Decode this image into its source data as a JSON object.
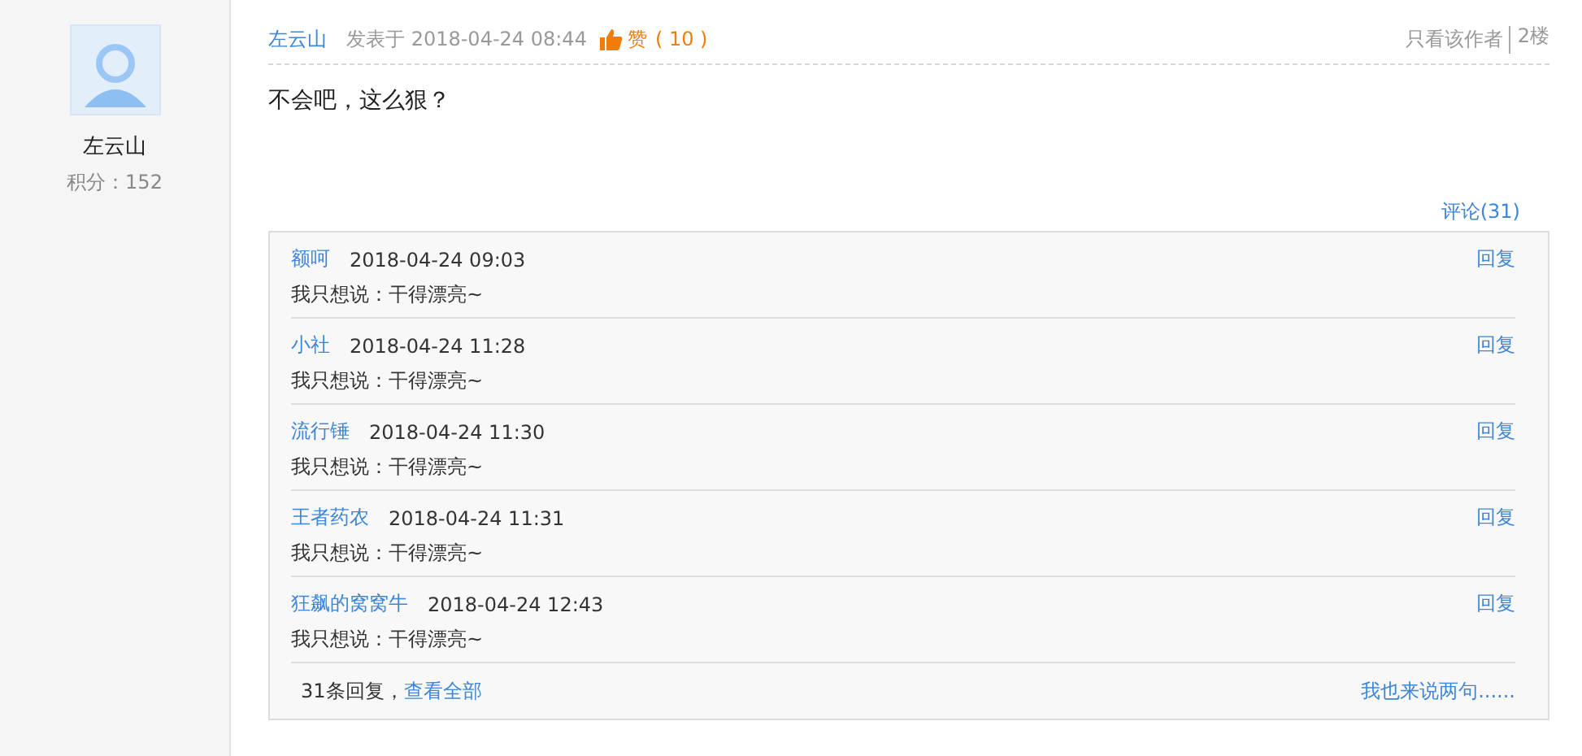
{
  "author": {
    "name": "左云山",
    "score": "积分：152"
  },
  "post": {
    "author": "左云山",
    "posted": "发表于 2018-04-24 08:44",
    "like_label": "赞",
    "like_count": "( 10 )",
    "author_only": "只看该作者",
    "floor": "2楼",
    "body": "不会吧，这么狠？",
    "comments_link": "评论(31)"
  },
  "comments": [
    {
      "user": "额呵",
      "time": "2018-04-24 09:03",
      "text": "我只想说：干得漂亮~",
      "reply": "回复"
    },
    {
      "user": "小社",
      "time": "2018-04-24 11:28",
      "text": "我只想说：干得漂亮~",
      "reply": "回复"
    },
    {
      "user": "流行锤",
      "time": "2018-04-24 11:30",
      "text": "我只想说：干得漂亮~",
      "reply": "回复"
    },
    {
      "user": "王者药农",
      "time": "2018-04-24 11:31",
      "text": "我只想说：干得漂亮~",
      "reply": "回复"
    },
    {
      "user": "狂飙的窝窝牛",
      "time": "2018-04-24 12:43",
      "text": "我只想说：干得漂亮~",
      "reply": "回复"
    }
  ],
  "footer": {
    "count": "31条回复，",
    "view_all": "查看全部",
    "write": "我也来说两句......"
  }
}
